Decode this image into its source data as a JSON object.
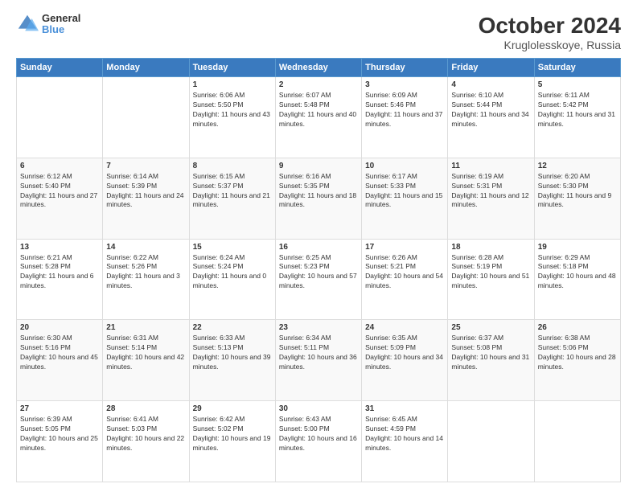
{
  "logo": {
    "line1": "General",
    "line2": "Blue"
  },
  "title": "October 2024",
  "subtitle": "Kruglolesskoye, Russia",
  "days_of_week": [
    "Sunday",
    "Monday",
    "Tuesday",
    "Wednesday",
    "Thursday",
    "Friday",
    "Saturday"
  ],
  "weeks": [
    [
      {
        "day": "",
        "sunrise": "",
        "sunset": "",
        "daylight": ""
      },
      {
        "day": "",
        "sunrise": "",
        "sunset": "",
        "daylight": ""
      },
      {
        "day": "1",
        "sunrise": "Sunrise: 6:06 AM",
        "sunset": "Sunset: 5:50 PM",
        "daylight": "Daylight: 11 hours and 43 minutes."
      },
      {
        "day": "2",
        "sunrise": "Sunrise: 6:07 AM",
        "sunset": "Sunset: 5:48 PM",
        "daylight": "Daylight: 11 hours and 40 minutes."
      },
      {
        "day": "3",
        "sunrise": "Sunrise: 6:09 AM",
        "sunset": "Sunset: 5:46 PM",
        "daylight": "Daylight: 11 hours and 37 minutes."
      },
      {
        "day": "4",
        "sunrise": "Sunrise: 6:10 AM",
        "sunset": "Sunset: 5:44 PM",
        "daylight": "Daylight: 11 hours and 34 minutes."
      },
      {
        "day": "5",
        "sunrise": "Sunrise: 6:11 AM",
        "sunset": "Sunset: 5:42 PM",
        "daylight": "Daylight: 11 hours and 31 minutes."
      }
    ],
    [
      {
        "day": "6",
        "sunrise": "Sunrise: 6:12 AM",
        "sunset": "Sunset: 5:40 PM",
        "daylight": "Daylight: 11 hours and 27 minutes."
      },
      {
        "day": "7",
        "sunrise": "Sunrise: 6:14 AM",
        "sunset": "Sunset: 5:39 PM",
        "daylight": "Daylight: 11 hours and 24 minutes."
      },
      {
        "day": "8",
        "sunrise": "Sunrise: 6:15 AM",
        "sunset": "Sunset: 5:37 PM",
        "daylight": "Daylight: 11 hours and 21 minutes."
      },
      {
        "day": "9",
        "sunrise": "Sunrise: 6:16 AM",
        "sunset": "Sunset: 5:35 PM",
        "daylight": "Daylight: 11 hours and 18 minutes."
      },
      {
        "day": "10",
        "sunrise": "Sunrise: 6:17 AM",
        "sunset": "Sunset: 5:33 PM",
        "daylight": "Daylight: 11 hours and 15 minutes."
      },
      {
        "day": "11",
        "sunrise": "Sunrise: 6:19 AM",
        "sunset": "Sunset: 5:31 PM",
        "daylight": "Daylight: 11 hours and 12 minutes."
      },
      {
        "day": "12",
        "sunrise": "Sunrise: 6:20 AM",
        "sunset": "Sunset: 5:30 PM",
        "daylight": "Daylight: 11 hours and 9 minutes."
      }
    ],
    [
      {
        "day": "13",
        "sunrise": "Sunrise: 6:21 AM",
        "sunset": "Sunset: 5:28 PM",
        "daylight": "Daylight: 11 hours and 6 minutes."
      },
      {
        "day": "14",
        "sunrise": "Sunrise: 6:22 AM",
        "sunset": "Sunset: 5:26 PM",
        "daylight": "Daylight: 11 hours and 3 minutes."
      },
      {
        "day": "15",
        "sunrise": "Sunrise: 6:24 AM",
        "sunset": "Sunset: 5:24 PM",
        "daylight": "Daylight: 11 hours and 0 minutes."
      },
      {
        "day": "16",
        "sunrise": "Sunrise: 6:25 AM",
        "sunset": "Sunset: 5:23 PM",
        "daylight": "Daylight: 10 hours and 57 minutes."
      },
      {
        "day": "17",
        "sunrise": "Sunrise: 6:26 AM",
        "sunset": "Sunset: 5:21 PM",
        "daylight": "Daylight: 10 hours and 54 minutes."
      },
      {
        "day": "18",
        "sunrise": "Sunrise: 6:28 AM",
        "sunset": "Sunset: 5:19 PM",
        "daylight": "Daylight: 10 hours and 51 minutes."
      },
      {
        "day": "19",
        "sunrise": "Sunrise: 6:29 AM",
        "sunset": "Sunset: 5:18 PM",
        "daylight": "Daylight: 10 hours and 48 minutes."
      }
    ],
    [
      {
        "day": "20",
        "sunrise": "Sunrise: 6:30 AM",
        "sunset": "Sunset: 5:16 PM",
        "daylight": "Daylight: 10 hours and 45 minutes."
      },
      {
        "day": "21",
        "sunrise": "Sunrise: 6:31 AM",
        "sunset": "Sunset: 5:14 PM",
        "daylight": "Daylight: 10 hours and 42 minutes."
      },
      {
        "day": "22",
        "sunrise": "Sunrise: 6:33 AM",
        "sunset": "Sunset: 5:13 PM",
        "daylight": "Daylight: 10 hours and 39 minutes."
      },
      {
        "day": "23",
        "sunrise": "Sunrise: 6:34 AM",
        "sunset": "Sunset: 5:11 PM",
        "daylight": "Daylight: 10 hours and 36 minutes."
      },
      {
        "day": "24",
        "sunrise": "Sunrise: 6:35 AM",
        "sunset": "Sunset: 5:09 PM",
        "daylight": "Daylight: 10 hours and 34 minutes."
      },
      {
        "day": "25",
        "sunrise": "Sunrise: 6:37 AM",
        "sunset": "Sunset: 5:08 PM",
        "daylight": "Daylight: 10 hours and 31 minutes."
      },
      {
        "day": "26",
        "sunrise": "Sunrise: 6:38 AM",
        "sunset": "Sunset: 5:06 PM",
        "daylight": "Daylight: 10 hours and 28 minutes."
      }
    ],
    [
      {
        "day": "27",
        "sunrise": "Sunrise: 6:39 AM",
        "sunset": "Sunset: 5:05 PM",
        "daylight": "Daylight: 10 hours and 25 minutes."
      },
      {
        "day": "28",
        "sunrise": "Sunrise: 6:41 AM",
        "sunset": "Sunset: 5:03 PM",
        "daylight": "Daylight: 10 hours and 22 minutes."
      },
      {
        "day": "29",
        "sunrise": "Sunrise: 6:42 AM",
        "sunset": "Sunset: 5:02 PM",
        "daylight": "Daylight: 10 hours and 19 minutes."
      },
      {
        "day": "30",
        "sunrise": "Sunrise: 6:43 AM",
        "sunset": "Sunset: 5:00 PM",
        "daylight": "Daylight: 10 hours and 16 minutes."
      },
      {
        "day": "31",
        "sunrise": "Sunrise: 6:45 AM",
        "sunset": "Sunset: 4:59 PM",
        "daylight": "Daylight: 10 hours and 14 minutes."
      },
      {
        "day": "",
        "sunrise": "",
        "sunset": "",
        "daylight": ""
      },
      {
        "day": "",
        "sunrise": "",
        "sunset": "",
        "daylight": ""
      }
    ]
  ]
}
